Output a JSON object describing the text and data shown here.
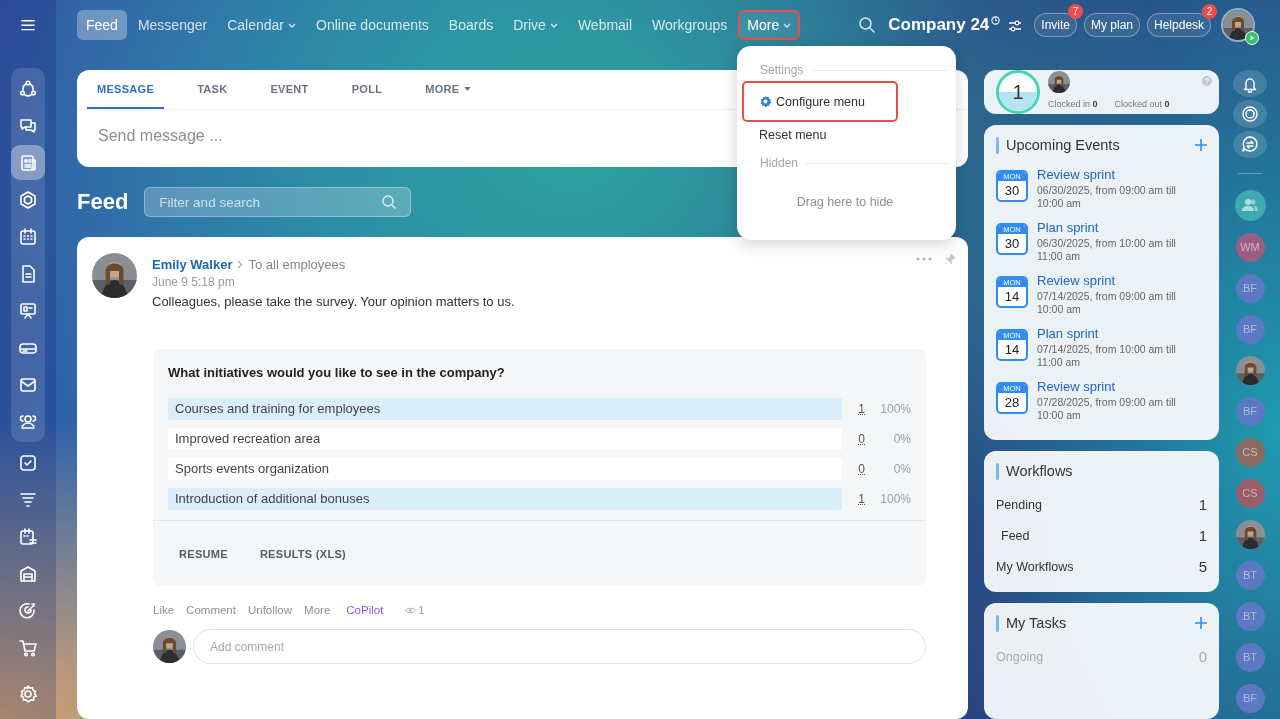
{
  "top_bar": {
    "nav": [
      {
        "label": "Feed",
        "selected": true,
        "caret": false,
        "highlighted": false
      },
      {
        "label": "Messenger",
        "selected": false,
        "caret": false,
        "highlighted": false
      },
      {
        "label": "Calendar",
        "selected": false,
        "caret": true,
        "highlighted": false
      },
      {
        "label": "Online documents",
        "selected": false,
        "caret": false,
        "highlighted": false
      },
      {
        "label": "Boards",
        "selected": false,
        "caret": false,
        "highlighted": false
      },
      {
        "label": "Drive",
        "selected": false,
        "caret": true,
        "highlighted": false
      },
      {
        "label": "Webmail",
        "selected": false,
        "caret": false,
        "highlighted": false
      },
      {
        "label": "Workgroups",
        "selected": false,
        "caret": false,
        "highlighted": false
      },
      {
        "label": "More",
        "selected": false,
        "caret": true,
        "highlighted": true
      }
    ],
    "company": "Company 24",
    "buttons": [
      {
        "label": "Invite",
        "badge": "7"
      },
      {
        "label": "My plan"
      },
      {
        "label": "Helpdesk",
        "badge": "2"
      }
    ]
  },
  "sidebar": {
    "group": [
      {
        "selected": false
      },
      {
        "selected": false
      },
      {
        "selected": true
      },
      {
        "selected": false
      },
      {
        "selected": false
      },
      {
        "selected": false
      },
      {
        "selected": false
      },
      {
        "selected": false
      },
      {
        "selected": false
      },
      {
        "selected": false
      }
    ],
    "more": [
      {
        "selected": false
      },
      {
        "selected": false
      },
      {
        "selected": false
      },
      {
        "selected": false
      },
      {
        "selected": false
      },
      {
        "selected": false
      },
      {
        "selected": false
      }
    ]
  },
  "composer": {
    "tabs": [
      {
        "label": "MESSAGE",
        "selected": true,
        "caret": false
      },
      {
        "label": "TASK",
        "selected": false,
        "caret": false
      },
      {
        "label": "EVENT",
        "selected": false,
        "caret": false
      },
      {
        "label": "POLL",
        "selected": false,
        "caret": false
      },
      {
        "label": "MORE",
        "selected": false,
        "caret": true
      }
    ],
    "placeholder": "Send message ..."
  },
  "feed": {
    "title": "Feed",
    "filter_placeholder": "Filter and search"
  },
  "post": {
    "author": "Emily Walker",
    "audience": "To all employees",
    "time": "June 9 5:18 pm",
    "text": "Colleagues, please take the survey. Your opinion matters to us.",
    "poll": {
      "question": "What initiatives would you like to see in the company?",
      "answers": [
        {
          "text": "Courses and training for employees",
          "count": "1",
          "percent": "100%",
          "level": 1
        },
        {
          "text": "Improved recreation area",
          "count": "0",
          "percent": "0%",
          "level": 0
        },
        {
          "text": "Sports events organization",
          "count": "0",
          "percent": "0%",
          "level": 0
        },
        {
          "text": "Introduction of additional bonuses",
          "count": "1",
          "percent": "100%",
          "level": 1
        }
      ],
      "buttons": [
        "RESUME",
        "RESULTS (XLS)"
      ]
    },
    "actions": [
      {
        "label": "Like",
        "kind": "plain"
      },
      {
        "label": "Comment",
        "kind": "plain"
      },
      {
        "label": "Unfollow",
        "kind": "plain"
      },
      {
        "label": "More",
        "kind": "plain"
      },
      {
        "label": "CoPilot",
        "kind": "copilot"
      }
    ],
    "views": "1",
    "comment_placeholder": "Add comment"
  },
  "more_menu": {
    "settings_title": "Settings",
    "items": [
      {
        "label": "Configure menu",
        "kind": "configure",
        "highlighted": true
      },
      {
        "label": "Reset menu",
        "kind": "reset",
        "highlighted": false
      }
    ],
    "hidden_title": "Hidden",
    "hidden_hint": "Drag here to hide"
  },
  "timeman": {
    "count": "1",
    "clocked_in_label": "Clocked in",
    "clocked_in": "0",
    "clocked_out_label": "Clocked out",
    "clocked_out": "0"
  },
  "events": {
    "title": "Upcoming Events",
    "items": [
      {
        "weekday": "MON",
        "day": "30",
        "title": "Review sprint",
        "when": "06/30/2025, from 09:00 am till 10:00 am"
      },
      {
        "weekday": "MON",
        "day": "30",
        "title": "Plan sprint",
        "when": "06/30/2025, from 10:00 am till 11:00 am"
      },
      {
        "weekday": "MON",
        "day": "14",
        "title": "Review sprint",
        "when": "07/14/2025, from 09:00 am till 10:00 am"
      },
      {
        "weekday": "MON",
        "day": "14",
        "title": "Plan sprint",
        "when": "07/14/2025, from 10:00 am till 11:00 am"
      },
      {
        "weekday": "MON",
        "day": "28",
        "title": "Review sprint",
        "when": "07/28/2025, from 09:00 am till 10:00 am"
      }
    ]
  },
  "workflows": {
    "title": "Workflows",
    "rows": [
      {
        "label": "Pending",
        "value": "1",
        "children": [
          {
            "label": "Feed",
            "value": "1"
          }
        ]
      },
      {
        "label": "My Workflows",
        "value": "5"
      }
    ]
  },
  "tasks": {
    "title": "My Tasks",
    "rows": [
      {
        "label": "Ongoing",
        "value": "0"
      }
    ]
  },
  "rail": {
    "avatars": [
      {
        "kind": "group"
      },
      {
        "kind": "initials",
        "initials": "WM",
        "color": "#9c5d82"
      },
      {
        "kind": "initials",
        "initials": "BF",
        "color": "#5b78c2"
      },
      {
        "kind": "initials",
        "initials": "BF",
        "color": "#5b78c2"
      },
      {
        "kind": "photo"
      },
      {
        "kind": "initials",
        "initials": "BF",
        "color": "#5b78c2"
      },
      {
        "kind": "initials",
        "initials": "CS",
        "color": "#8a6a60"
      },
      {
        "kind": "initials",
        "initials": "CS",
        "color": "#9c5d6a"
      },
      {
        "kind": "photo"
      },
      {
        "kind": "initials",
        "initials": "BT",
        "color": "#5b78c2"
      },
      {
        "kind": "initials",
        "initials": "BT",
        "color": "#5b78c2"
      },
      {
        "kind": "initials",
        "initials": "BT",
        "color": "#5b78c2"
      },
      {
        "kind": "initials",
        "initials": "BF",
        "color": "#5b78c2"
      }
    ]
  }
}
